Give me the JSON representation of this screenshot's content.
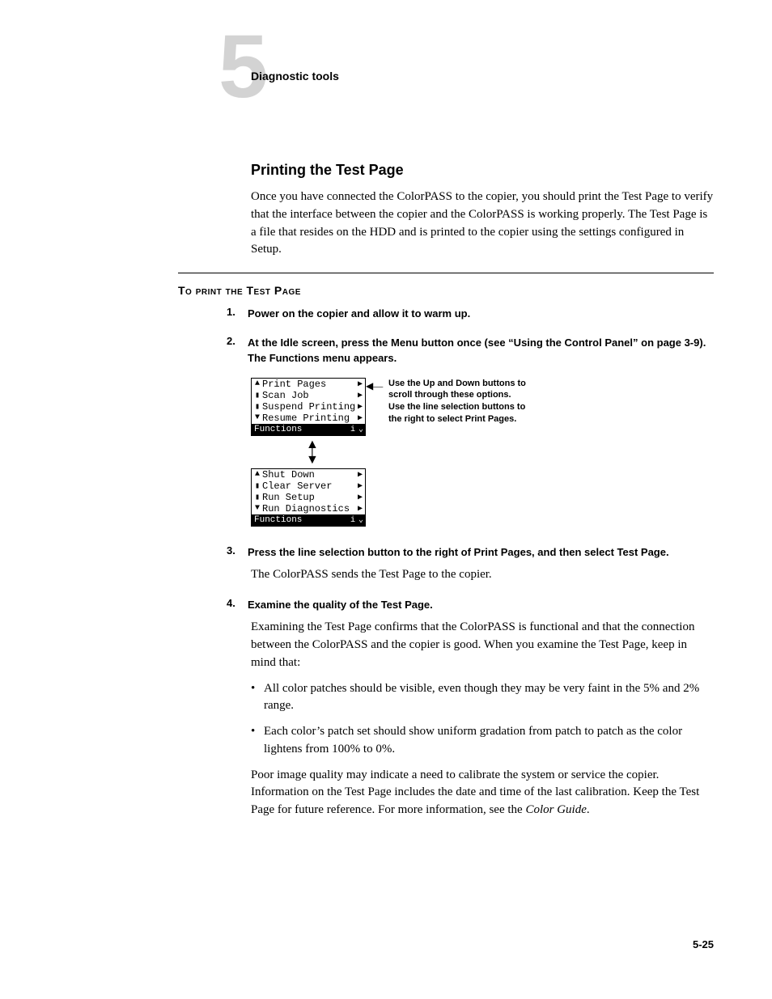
{
  "header": {
    "chapter_number": "5",
    "label": "Diagnostic tools"
  },
  "section": {
    "title": "Printing the Test Page",
    "intro": "Once you have connected the ColorPASS to the copier, you should print the Test Page to verify that the interface between the copier and the ColorPASS is working properly. The Test Page is a file that resides on the HDD and is printed to the copier using the settings configured in Setup."
  },
  "procedure": {
    "heading": "To print the Test Page"
  },
  "steps": {
    "s1": {
      "num": "1.",
      "text": "Power on the copier and allow it to warm up."
    },
    "s2": {
      "num": "2.",
      "text": "At the Idle screen, press the Menu button once (see “Using the Control Panel” on page 3-9). The Functions menu appears."
    },
    "s3": {
      "num": "3.",
      "text": "Press the line selection button to the right of Print Pages, and then select Test Page.",
      "body": "The ColorPASS sends the Test Page to the copier."
    },
    "s4": {
      "num": "4.",
      "text": "Examine the quality of the Test Page.",
      "body": "Examining the Test Page confirms that the ColorPASS is functional and that the connection between the ColorPASS and the copier is good. When you examine the Test Page, keep in mind that:"
    }
  },
  "lcd1": {
    "r1": "Print Pages",
    "r2": "Scan Job",
    "r3": "Suspend Printing",
    "r4": "Resume Printing",
    "footer": "Functions"
  },
  "lcd2": {
    "r1": "Shut Down",
    "r2": "Clear Server",
    "r3": "Run Setup",
    "r4": "Run Diagnostics",
    "footer": "Functions"
  },
  "callout": "Use the Up and Down buttons to scroll through these options. Use the line selection buttons to the right to select Print Pages.",
  "bullets": {
    "b1": "All color patches should be visible, even though they may be very faint in the 5% and 2% range.",
    "b2": "Each color’s patch set should show uniform gradation from patch to patch as the color lightens from 100% to 0%."
  },
  "closing": {
    "p1": "Poor image quality may indicate a need to calibrate the system or service the copier. Information on the Test Page includes the date and time of the last calibration. Keep the Test Page for future reference. For more information, see the ",
    "ref": "Color Guide",
    "p2": "."
  },
  "page_number": "5-25"
}
